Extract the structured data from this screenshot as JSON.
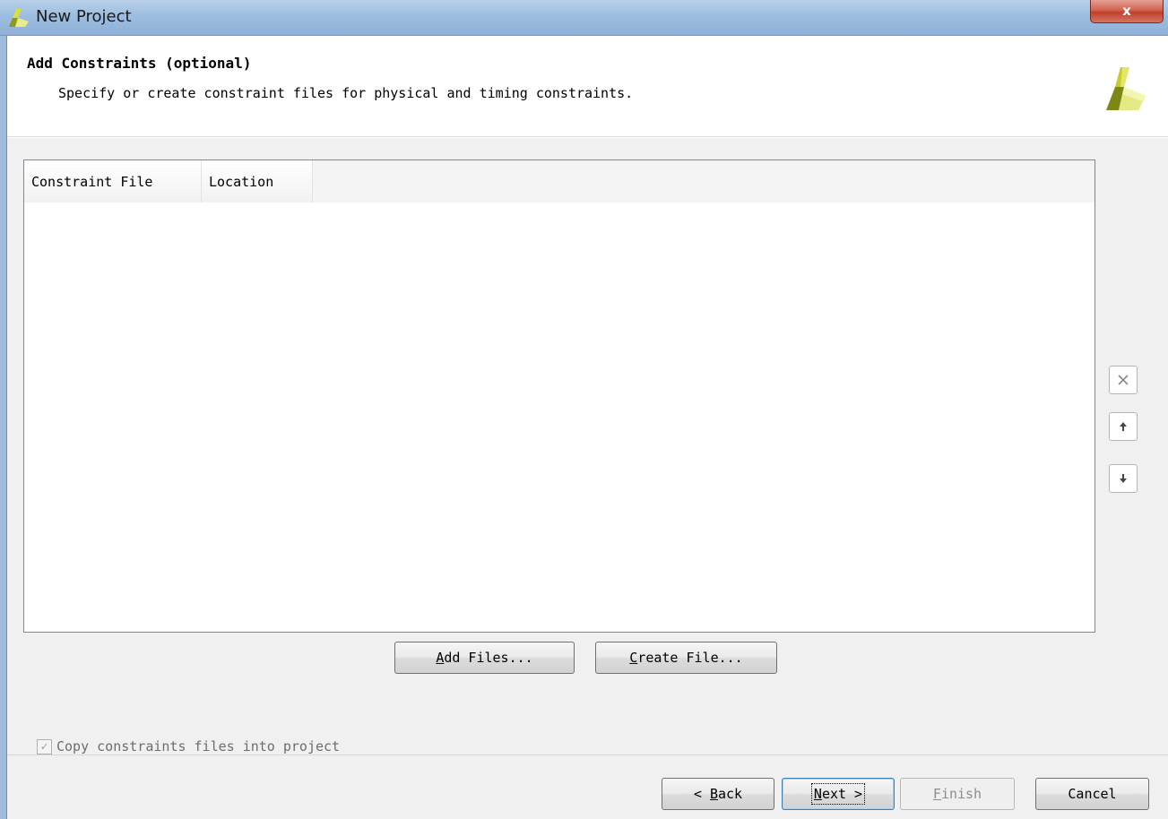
{
  "window": {
    "title": "New Project",
    "close_label": "x"
  },
  "header": {
    "title": "Add Constraints (optional)",
    "description": "Specify or create constraint files for physical and timing constraints."
  },
  "table": {
    "columns": [
      "Constraint File",
      "Location"
    ],
    "rows": []
  },
  "side_buttons": [
    {
      "name": "remove",
      "icon": "close-icon"
    },
    {
      "name": "move-up",
      "icon": "arrow-up-icon"
    },
    {
      "name": "move-down",
      "icon": "arrow-down-icon"
    }
  ],
  "actions": {
    "add_files": {
      "mnemonic": "A",
      "rest": "dd Files..."
    },
    "create_file": {
      "mnemonic": "C",
      "rest": "reate File..."
    }
  },
  "options": {
    "copy_constraints": {
      "label": "Copy constraints files into project",
      "checked": true,
      "enabled": false
    }
  },
  "footer": {
    "back": {
      "prefix": "< ",
      "mnemonic": "B",
      "rest": "ack"
    },
    "next": {
      "mnemonic": "N",
      "rest": "ext >"
    },
    "finish": {
      "mnemonic": "F",
      "rest": "inish",
      "enabled": false
    },
    "cancel": {
      "label": "Cancel"
    }
  },
  "colors": {
    "logo_dark": "#6f7a10",
    "logo_light": "#e8ec7a",
    "titlebar": "#9dbde0"
  }
}
